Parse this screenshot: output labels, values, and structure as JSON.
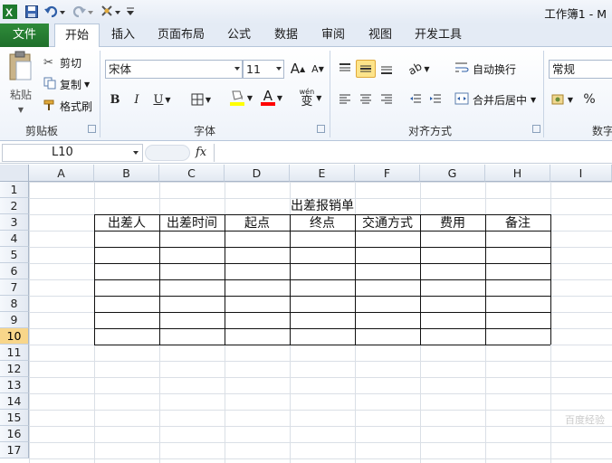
{
  "titlebar": {
    "title": "工作簿1 - M",
    "quick_access": [
      "save-icon",
      "undo-icon",
      "redo-icon",
      "format-painter-icon",
      "customize-icon"
    ]
  },
  "tabs": [
    "文件",
    "开始",
    "插入",
    "页面布局",
    "公式",
    "数据",
    "审阅",
    "视图",
    "开发工具"
  ],
  "active_tab": "开始",
  "clipboard": {
    "paste": "粘贴",
    "cut": "剪切",
    "copy": "复制",
    "format_painter": "格式刷",
    "label": "剪贴板"
  },
  "font": {
    "name": "宋体",
    "size": "11",
    "grow": "A",
    "shrink": "A",
    "bold": "B",
    "italic": "I",
    "underline": "U",
    "font_color_glyph": "A",
    "phonetic": "wén",
    "phonetic_char": "变",
    "label": "字体",
    "fill_color": "#ffff00",
    "font_color": "#ff0000"
  },
  "alignment": {
    "wrap": "自动换行",
    "merge": "合并后居中",
    "label": "对齐方式"
  },
  "number": {
    "format": "常规",
    "percent": "%",
    "label": "数字"
  },
  "formula_bar": {
    "name_box": "L10",
    "fx": "fx",
    "value": ""
  },
  "columns": [
    "A",
    "B",
    "C",
    "D",
    "E",
    "F",
    "G",
    "H",
    "I"
  ],
  "rows": [
    "1",
    "2",
    "3",
    "4",
    "5",
    "6",
    "7",
    "8",
    "9",
    "10",
    "11",
    "12",
    "13",
    "14",
    "15",
    "16",
    "17"
  ],
  "selected_row": "10",
  "sheet": {
    "title": "出差报销单",
    "headers": [
      "出差人",
      "出差时间",
      "起点",
      "终点",
      "交通方式",
      "费用",
      "备注"
    ]
  },
  "watermark": "百度经验"
}
